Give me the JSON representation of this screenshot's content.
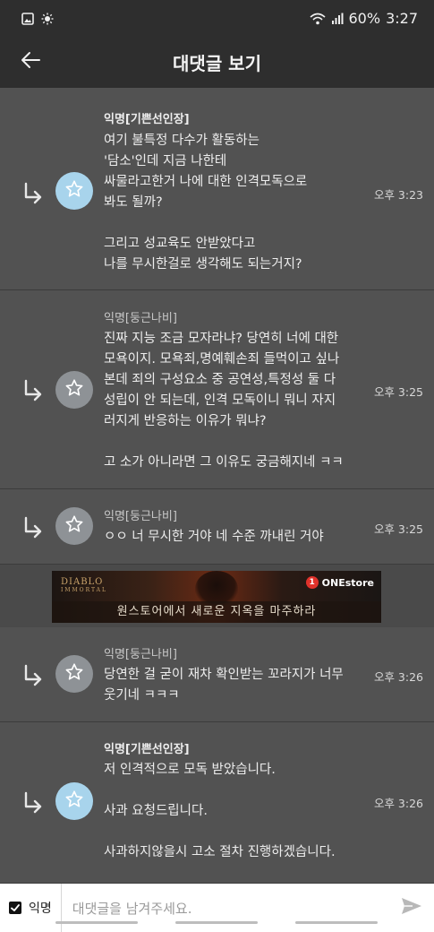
{
  "status_bar": {
    "battery": "60%",
    "time": "3:27"
  },
  "app_bar": {
    "title": "대댓글 보기"
  },
  "comments": [
    {
      "author": "익명[기쁜선인장]",
      "is_op": true,
      "time": "오후 3:23",
      "body": "여기 불특정 다수가 활동하는\n'담소'인데 지금 나한테\n싸물라고한거 나에 대한 인격모독으로\n봐도 될까?\n\n그리고 성교육도 안받았다고\n나를 무시한걸로 생각해도 되는거지?"
    },
    {
      "author": "익명[둥근나비]",
      "is_op": false,
      "time": "오후 3:25",
      "body": "진짜 지능 조금 모자라냐? 당연히 너에 대한\n모욕이지. 모욕죄,명예훼손죄 들먹이고 싶나\n본데 죄의 구성요소 중 공연성,특정성 둘 다\n성립이 안 되는데, 인격 모독이니 뭐니 자지\n러지게 반응하는 이유가 뭐냐?\n\n고 소가 아니라면 그 이유도 궁금해지네 ㅋㅋ"
    },
    {
      "author": "익명[둥근나비]",
      "is_op": false,
      "time": "오후 3:25",
      "body": "ㅇㅇ 너 무시한 거야 네 수준 까내린 거야"
    },
    {
      "author": "익명[둥근나비]",
      "is_op": false,
      "time": "오후 3:26",
      "body": "당연한 걸 굳이 재차 확인받는 꼬라지가 너무\n웃기네 ㅋㅋㅋ"
    },
    {
      "author": "익명[기쁜선인장]",
      "is_op": true,
      "time": "오후 3:26",
      "body": "저 인격적으로 모독 받았습니다.\n\n사과 요청드립니다.\n\n사과하지않을시 고소 절차 진행하겠습니다."
    }
  ],
  "ad": {
    "logo": "DIABLO",
    "logo_sub": "IMMORTAL",
    "brand_badge": "1",
    "brand": "ONEstore",
    "caption": "원스토어에서 새로운 지옥을 마주하라"
  },
  "input_bar": {
    "anon_label": "익명",
    "anon_checked": true,
    "placeholder": "대댓글을 남겨주세요."
  },
  "colors": {
    "background": "#4a4a4a",
    "bar": "#2e2e2e",
    "op_avatar": "#a8d4ec",
    "other_avatar": "#8e9296"
  }
}
